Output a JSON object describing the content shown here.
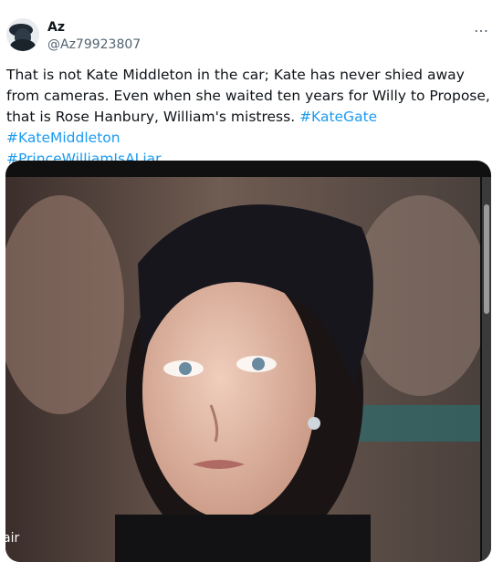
{
  "tweet": {
    "author_name": "Az",
    "author_handle": "@Az79923807",
    "text_before": "That is not Kate Middleton in the car; Kate has never shied away from cameras. Even when she waited ten years for Willy to Propose, that is Rose Hanbury, William's mistress. ",
    "hashtags": [
      "#KateGate",
      "#KateMiddleton",
      "#PrinceWilliamIsALiar"
    ],
    "more_icon": "…",
    "media_overlay_text": "air"
  },
  "colors": {
    "link": "#1d9bf0",
    "text": "#0f1419",
    "secondary": "#536471"
  },
  "icons": {
    "more": "more-horizontal-icon",
    "avatar": "avatar-image"
  }
}
